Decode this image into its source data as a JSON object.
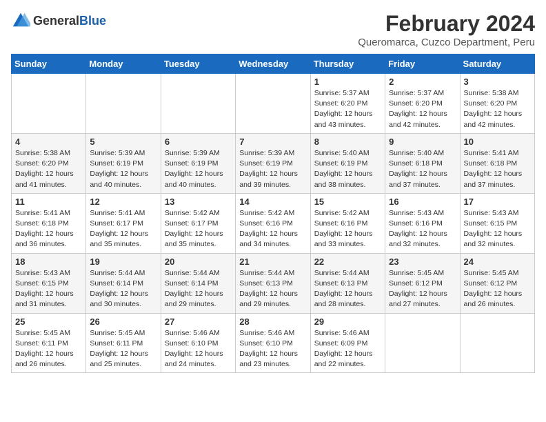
{
  "logo": {
    "general": "General",
    "blue": "Blue"
  },
  "title": "February 2024",
  "subtitle": "Queromarca, Cuzco Department, Peru",
  "weekdays": [
    "Sunday",
    "Monday",
    "Tuesday",
    "Wednesday",
    "Thursday",
    "Friday",
    "Saturday"
  ],
  "weeks": [
    [
      {
        "day": "",
        "detail": ""
      },
      {
        "day": "",
        "detail": ""
      },
      {
        "day": "",
        "detail": ""
      },
      {
        "day": "",
        "detail": ""
      },
      {
        "day": "1",
        "detail": "Sunrise: 5:37 AM\nSunset: 6:20 PM\nDaylight: 12 hours\nand 43 minutes."
      },
      {
        "day": "2",
        "detail": "Sunrise: 5:37 AM\nSunset: 6:20 PM\nDaylight: 12 hours\nand 42 minutes."
      },
      {
        "day": "3",
        "detail": "Sunrise: 5:38 AM\nSunset: 6:20 PM\nDaylight: 12 hours\nand 42 minutes."
      }
    ],
    [
      {
        "day": "4",
        "detail": "Sunrise: 5:38 AM\nSunset: 6:20 PM\nDaylight: 12 hours\nand 41 minutes."
      },
      {
        "day": "5",
        "detail": "Sunrise: 5:39 AM\nSunset: 6:19 PM\nDaylight: 12 hours\nand 40 minutes."
      },
      {
        "day": "6",
        "detail": "Sunrise: 5:39 AM\nSunset: 6:19 PM\nDaylight: 12 hours\nand 40 minutes."
      },
      {
        "day": "7",
        "detail": "Sunrise: 5:39 AM\nSunset: 6:19 PM\nDaylight: 12 hours\nand 39 minutes."
      },
      {
        "day": "8",
        "detail": "Sunrise: 5:40 AM\nSunset: 6:19 PM\nDaylight: 12 hours\nand 38 minutes."
      },
      {
        "day": "9",
        "detail": "Sunrise: 5:40 AM\nSunset: 6:18 PM\nDaylight: 12 hours\nand 37 minutes."
      },
      {
        "day": "10",
        "detail": "Sunrise: 5:41 AM\nSunset: 6:18 PM\nDaylight: 12 hours\nand 37 minutes."
      }
    ],
    [
      {
        "day": "11",
        "detail": "Sunrise: 5:41 AM\nSunset: 6:18 PM\nDaylight: 12 hours\nand 36 minutes."
      },
      {
        "day": "12",
        "detail": "Sunrise: 5:41 AM\nSunset: 6:17 PM\nDaylight: 12 hours\nand 35 minutes."
      },
      {
        "day": "13",
        "detail": "Sunrise: 5:42 AM\nSunset: 6:17 PM\nDaylight: 12 hours\nand 35 minutes."
      },
      {
        "day": "14",
        "detail": "Sunrise: 5:42 AM\nSunset: 6:16 PM\nDaylight: 12 hours\nand 34 minutes."
      },
      {
        "day": "15",
        "detail": "Sunrise: 5:42 AM\nSunset: 6:16 PM\nDaylight: 12 hours\nand 33 minutes."
      },
      {
        "day": "16",
        "detail": "Sunrise: 5:43 AM\nSunset: 6:16 PM\nDaylight: 12 hours\nand 32 minutes."
      },
      {
        "day": "17",
        "detail": "Sunrise: 5:43 AM\nSunset: 6:15 PM\nDaylight: 12 hours\nand 32 minutes."
      }
    ],
    [
      {
        "day": "18",
        "detail": "Sunrise: 5:43 AM\nSunset: 6:15 PM\nDaylight: 12 hours\nand 31 minutes."
      },
      {
        "day": "19",
        "detail": "Sunrise: 5:44 AM\nSunset: 6:14 PM\nDaylight: 12 hours\nand 30 minutes."
      },
      {
        "day": "20",
        "detail": "Sunrise: 5:44 AM\nSunset: 6:14 PM\nDaylight: 12 hours\nand 29 minutes."
      },
      {
        "day": "21",
        "detail": "Sunrise: 5:44 AM\nSunset: 6:13 PM\nDaylight: 12 hours\nand 29 minutes."
      },
      {
        "day": "22",
        "detail": "Sunrise: 5:44 AM\nSunset: 6:13 PM\nDaylight: 12 hours\nand 28 minutes."
      },
      {
        "day": "23",
        "detail": "Sunrise: 5:45 AM\nSunset: 6:12 PM\nDaylight: 12 hours\nand 27 minutes."
      },
      {
        "day": "24",
        "detail": "Sunrise: 5:45 AM\nSunset: 6:12 PM\nDaylight: 12 hours\nand 26 minutes."
      }
    ],
    [
      {
        "day": "25",
        "detail": "Sunrise: 5:45 AM\nSunset: 6:11 PM\nDaylight: 12 hours\nand 26 minutes."
      },
      {
        "day": "26",
        "detail": "Sunrise: 5:45 AM\nSunset: 6:11 PM\nDaylight: 12 hours\nand 25 minutes."
      },
      {
        "day": "27",
        "detail": "Sunrise: 5:46 AM\nSunset: 6:10 PM\nDaylight: 12 hours\nand 24 minutes."
      },
      {
        "day": "28",
        "detail": "Sunrise: 5:46 AM\nSunset: 6:10 PM\nDaylight: 12 hours\nand 23 minutes."
      },
      {
        "day": "29",
        "detail": "Sunrise: 5:46 AM\nSunset: 6:09 PM\nDaylight: 12 hours\nand 22 minutes."
      },
      {
        "day": "",
        "detail": ""
      },
      {
        "day": "",
        "detail": ""
      }
    ]
  ]
}
